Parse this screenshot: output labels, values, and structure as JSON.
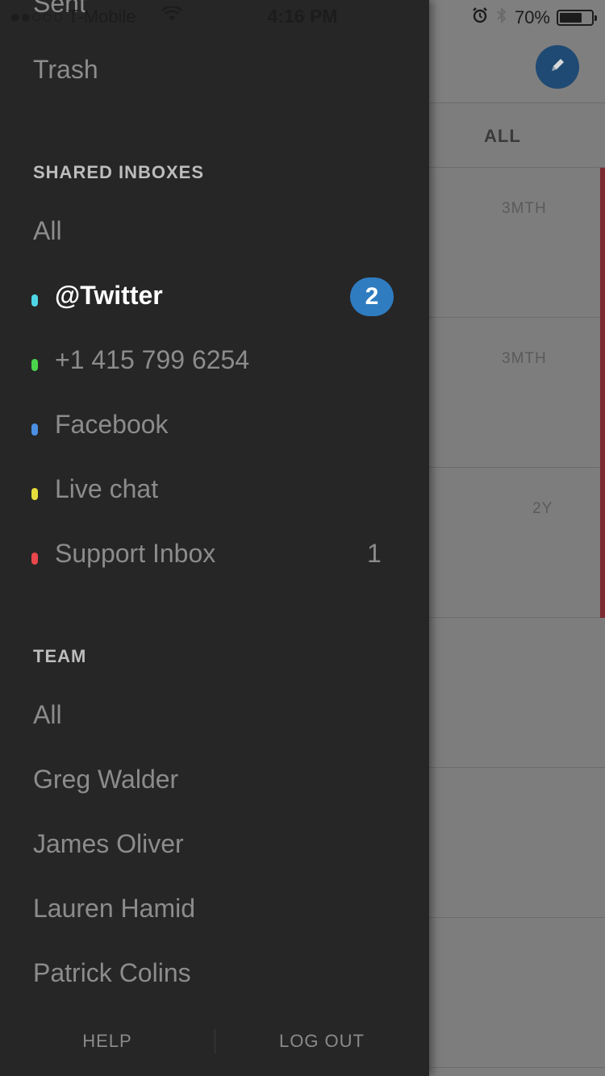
{
  "status_bar": {
    "carrier": "●●○○○ T-Mobile",
    "time": "4:16 PM",
    "battery": "70%",
    "battery_level": 0.7
  },
  "drawer": {
    "partial_item": "Sent",
    "trash": "Trash",
    "shared_inboxes": {
      "header": "SHARED INBOXES",
      "all": "All",
      "items": [
        {
          "label": "@Twitter",
          "color": "#4fd6e6",
          "badge": "2",
          "active": true
        },
        {
          "label": "+1 415 799 6254",
          "color": "#4cd34c"
        },
        {
          "label": "Facebook",
          "color": "#4a90e2"
        },
        {
          "label": "Live chat",
          "color": "#e6dc3c"
        },
        {
          "label": "Support Inbox",
          "color": "#e8474c",
          "count": "1"
        }
      ]
    },
    "team": {
      "header": "TEAM",
      "all": "All",
      "members": [
        "Greg Walder",
        "James Oliver",
        "Lauren Hamid",
        "Patrick Colins"
      ]
    },
    "footer": {
      "help": "HELP",
      "logout": "LOG OUT"
    }
  },
  "background": {
    "tab_label": "ALL",
    "rows": [
      {
        "time": "3MTH"
      },
      {
        "time": "3MTH"
      },
      {
        "time": "2Y"
      }
    ]
  },
  "colors": {
    "drawer_bg": "#262626",
    "accent_blue": "#2f7cc0",
    "compose_button": "#1f4a73"
  }
}
